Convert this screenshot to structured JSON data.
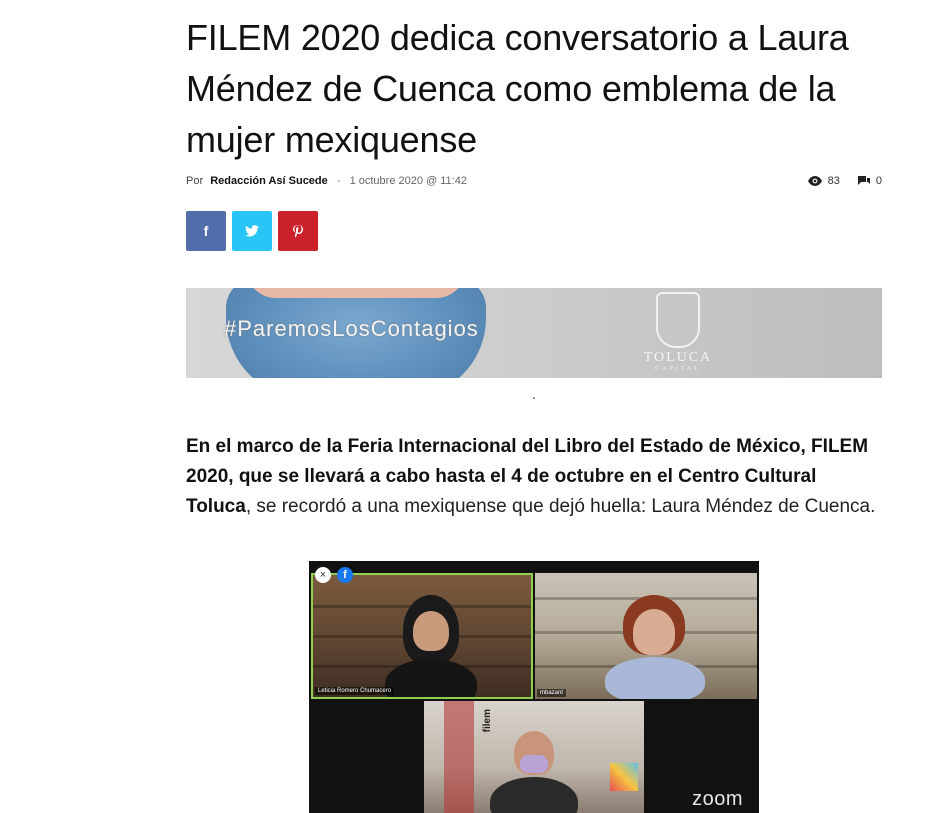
{
  "article": {
    "title": "FILEM 2020 dedica conversatorio a Laura Méndez de Cuenca como emblema de la mujer mexiquense",
    "meta": {
      "by_label": "Por",
      "author": "Redacción Así Sucede",
      "separator": "-",
      "date": "1 octubre 2020 @ 11:42",
      "views": "83",
      "comments": "0"
    },
    "share": {
      "facebook": "f",
      "twitter": "t",
      "pinterest": "p"
    },
    "banner": {
      "hashtag": "#ParemosLosContagios",
      "logo_city": "TOLUCA",
      "logo_sub": "CAPITAL"
    },
    "caption_dot": ".",
    "lead": {
      "bold": "En el marco de la Feria Internacional del Libro del Estado de México, FILEM 2020, que se llevará a cabo hasta el 4 de octubre en el Centro Cultural Toluca",
      "rest": ", se recordó a una mexiquense que dejó huella: Laura Méndez de Cuenca."
    },
    "video": {
      "participant_1": "Leticia Romero Chumacero",
      "participant_2": "mbazant",
      "sign_text": "filem",
      "zoom_label": "zoom",
      "close_icon": "×",
      "fb_icon": "f"
    }
  },
  "colors": {
    "facebook": "#516eab",
    "twitter": "#29c5f6",
    "pinterest": "#ca212a"
  }
}
